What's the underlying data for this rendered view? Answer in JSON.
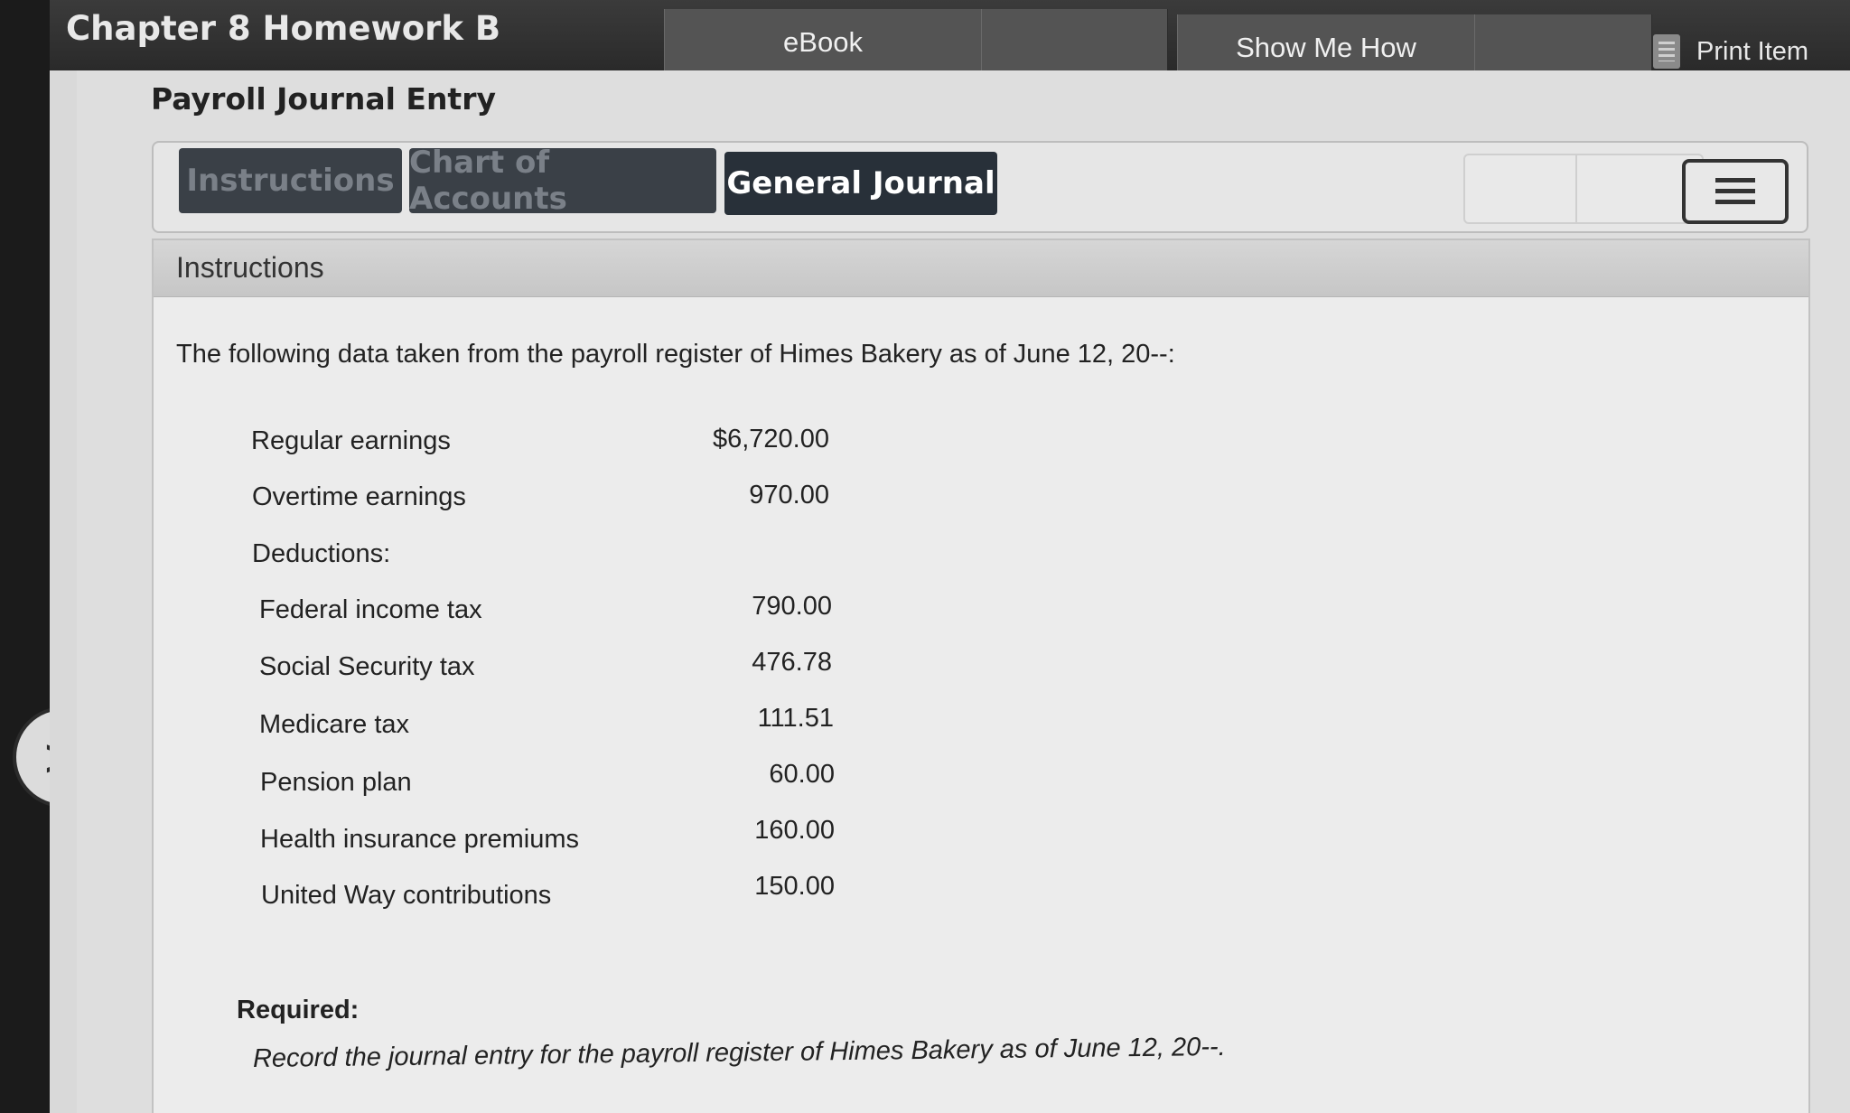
{
  "header": {
    "title": "Chapter 8 Homework B",
    "ebook_label": "eBook",
    "show_me_how_label": "Show Me How",
    "print_item_label": "Print Item"
  },
  "section_title": "Payroll Journal Entry",
  "tabs": [
    {
      "label": "Instructions",
      "active": false
    },
    {
      "label": "Chart of Accounts",
      "active": false
    },
    {
      "label": "General Journal",
      "active": true
    }
  ],
  "instructions": {
    "header": "Instructions",
    "intro": "The following data taken from the payroll register of Himes Bakery as of June 12, 20--:",
    "rows": [
      {
        "label": "Regular earnings",
        "value": "$6,720.00"
      },
      {
        "label": "Overtime earnings",
        "value": "970.00"
      },
      {
        "label": "Deductions:",
        "value": ""
      },
      {
        "label": "Federal income tax",
        "value": "790.00"
      },
      {
        "label": "Social Security tax",
        "value": "476.78"
      },
      {
        "label": "Medicare tax",
        "value": "111.51"
      },
      {
        "label": "Pension plan",
        "value": "60.00"
      },
      {
        "label": "Health insurance premiums",
        "value": "160.00"
      },
      {
        "label": "United Way contributions",
        "value": "150.00"
      }
    ],
    "required_label": "Required:",
    "required_text": "Record the journal entry for the payroll register of Himes Bakery as of June 12, 20--."
  },
  "icons": {
    "next": "chevron-right-icon",
    "menu": "menu-icon",
    "print": "print-icon"
  },
  "next_glyph": ">"
}
